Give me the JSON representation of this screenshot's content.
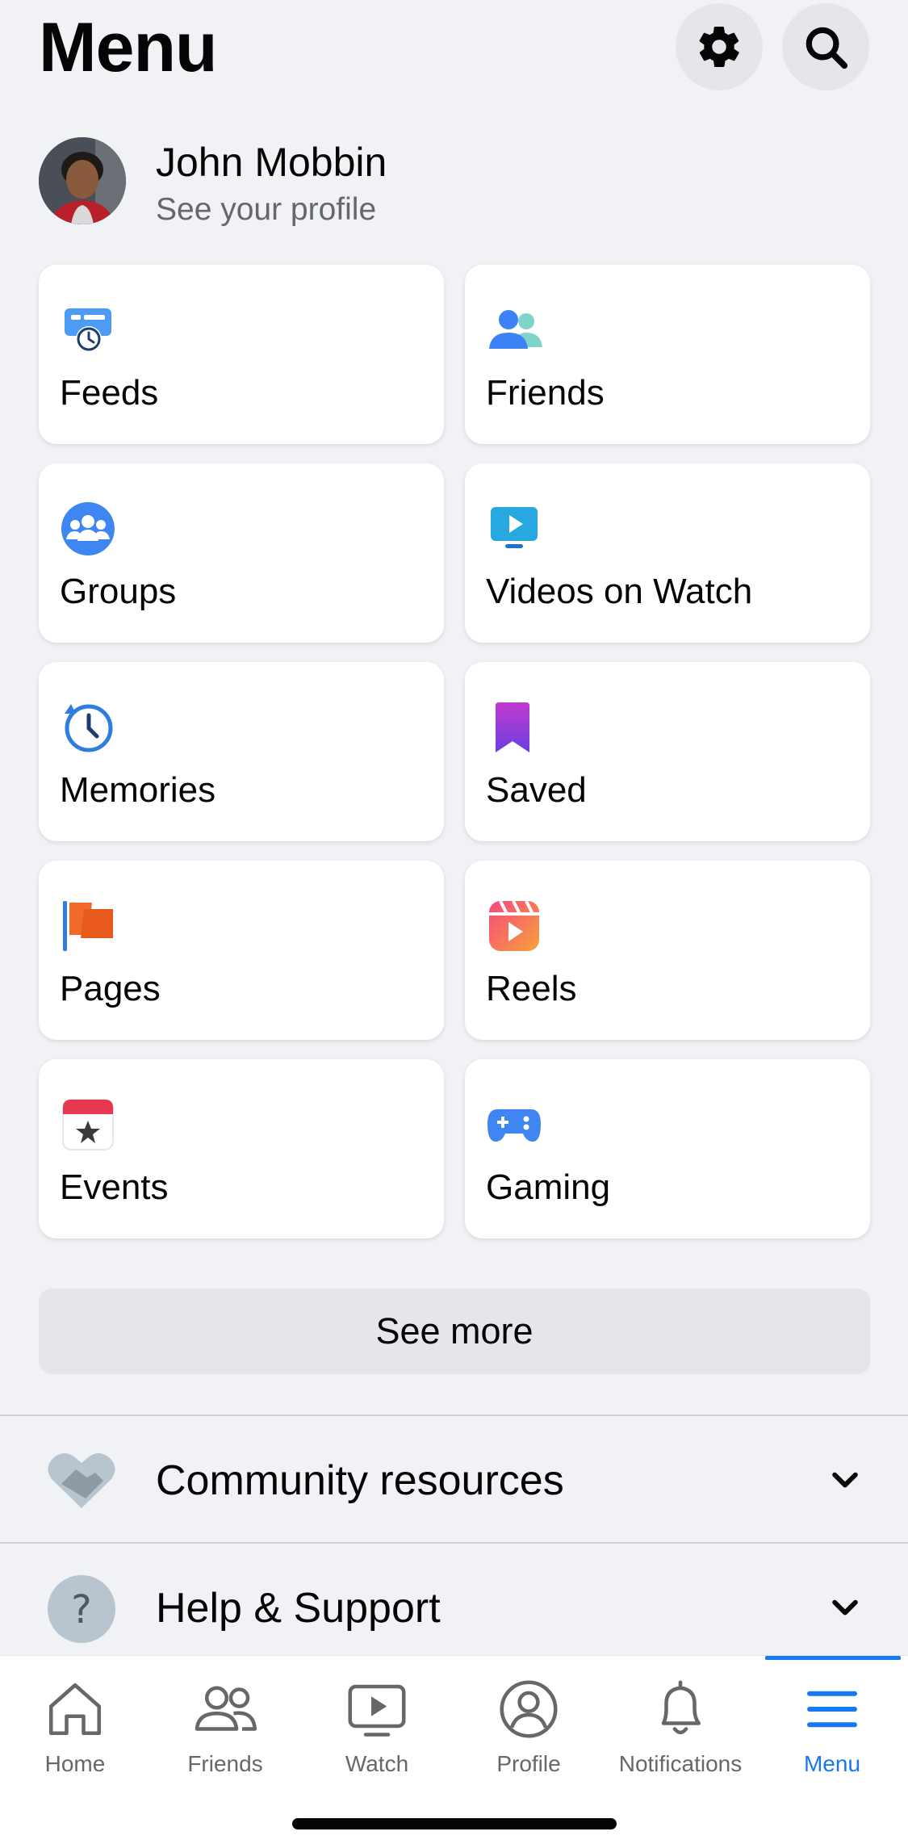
{
  "header": {
    "title": "Menu",
    "settings_icon": "gear-icon",
    "search_icon": "search-icon"
  },
  "profile": {
    "name": "John Mobbin",
    "subtitle": "See your profile"
  },
  "shortcuts": [
    {
      "label": "Feeds",
      "icon": "feeds-icon"
    },
    {
      "label": "Friends",
      "icon": "friends-icon"
    },
    {
      "label": "Groups",
      "icon": "groups-icon"
    },
    {
      "label": "Videos on Watch",
      "icon": "video-icon"
    },
    {
      "label": "Memories",
      "icon": "memories-clock-icon"
    },
    {
      "label": "Saved",
      "icon": "bookmark-icon"
    },
    {
      "label": "Pages",
      "icon": "flag-icon"
    },
    {
      "label": "Reels",
      "icon": "reels-icon"
    },
    {
      "label": "Events",
      "icon": "calendar-star-icon"
    },
    {
      "label": "Gaming",
      "icon": "gamepad-icon"
    }
  ],
  "see_more": "See more",
  "sections": [
    {
      "label": "Community resources",
      "icon": "handshake-icon"
    },
    {
      "label": "Help & Support",
      "icon": "question-icon"
    }
  ],
  "tabbar": {
    "items": [
      {
        "label": "Home",
        "icon": "home-icon"
      },
      {
        "label": "Friends",
        "icon": "friends-outline-icon"
      },
      {
        "label": "Watch",
        "icon": "watch-icon"
      },
      {
        "label": "Profile",
        "icon": "profile-icon"
      },
      {
        "label": "Notifications",
        "icon": "bell-icon"
      },
      {
        "label": "Menu",
        "icon": "menu-icon"
      }
    ],
    "active": "Menu"
  },
  "colors": {
    "accent": "#1877F2",
    "background": "#F0F2F5",
    "secondary_text": "#65676B"
  }
}
